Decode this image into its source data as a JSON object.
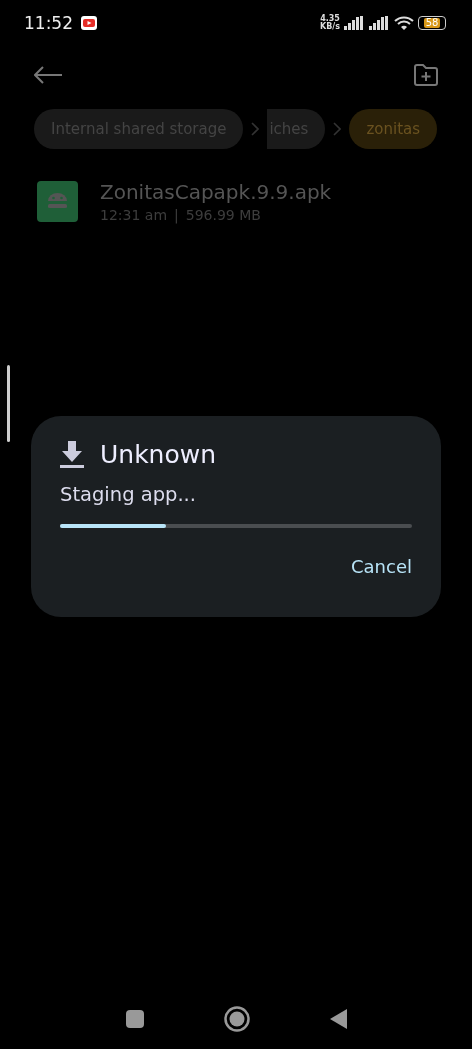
{
  "status_bar": {
    "time": "11:52",
    "net_speed": "4.35",
    "net_unit": "KB/s",
    "battery": "58"
  },
  "breadcrumbs": [
    {
      "label": "Internal shared storage",
      "selected": false,
      "cut": false
    },
    {
      "label": "iches",
      "selected": false,
      "cut": true
    },
    {
      "label": "zonitas",
      "selected": true,
      "cut": false
    }
  ],
  "files": [
    {
      "name": "ZonitasCapapk.9.9.apk",
      "time": "12:31 am",
      "separator": "|",
      "size": "596.99 MB"
    }
  ],
  "dialog": {
    "title": "Unknown",
    "message": "Staging app...",
    "level": 0.3,
    "button": "Cancel"
  }
}
